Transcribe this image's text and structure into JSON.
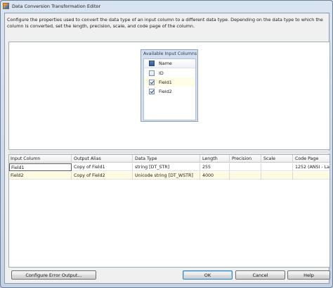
{
  "window": {
    "title": "Data Conversion Transformation Editor"
  },
  "description": "Configure the properties used to convert the data type of an input column to a different data type. Depending on the data type to which the column is converted, set the length, precision, scale, and code page of the column.",
  "available_columns": {
    "title": "Available Input Columns",
    "header": "Name",
    "items": [
      {
        "name": "ID",
        "checked": false
      },
      {
        "name": "Field1",
        "checked": true
      },
      {
        "name": "Field2",
        "checked": true
      }
    ]
  },
  "grid": {
    "columns": [
      "Input Column",
      "Output Alias",
      "Data Type",
      "Length",
      "Precision",
      "Scale",
      "Code Page"
    ],
    "rows": [
      [
        "Field1",
        "Copy of Field1",
        "string [DT_STR]",
        "255",
        "",
        "",
        "1252  (ANSI - La"
      ],
      [
        "Field2",
        "Copy of Field2",
        "Unicode string [DT_WSTR]",
        "4000",
        "",
        "",
        ""
      ]
    ]
  },
  "buttons": {
    "configure_error": "Configure Error Output...",
    "ok": "OK",
    "cancel": "Cancel",
    "help": "Help"
  }
}
